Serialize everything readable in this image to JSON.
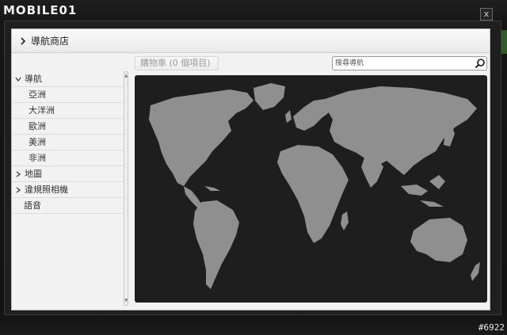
{
  "brand": {
    "logo_text": "MOBILE01"
  },
  "window": {
    "title": "導航商店",
    "close_label": "x"
  },
  "sidebar": {
    "items": [
      {
        "label": "導航",
        "level": 0,
        "expanded": true
      },
      {
        "label": "亞洲",
        "level": 1
      },
      {
        "label": "大洋洲",
        "level": 1
      },
      {
        "label": "歐洲",
        "level": 1
      },
      {
        "label": "美洲",
        "level": 1
      },
      {
        "label": "非洲",
        "level": 1
      },
      {
        "label": "地圖",
        "level": 0,
        "expanded": false
      },
      {
        "label": "違規照相機",
        "level": 0,
        "expanded": false
      },
      {
        "label": "語音",
        "level": 0
      }
    ]
  },
  "cart": {
    "label": "購物車 (0 個項目)"
  },
  "search": {
    "placeholder": "搜尋導航",
    "value": ""
  },
  "map": {
    "icon": "world-map",
    "land_color": "#8f8f8f",
    "ocean_color": "#1e1e1e"
  },
  "watermark": "#6922",
  "colors": {
    "accent_green": "#2f5d24",
    "background": "#121212"
  }
}
